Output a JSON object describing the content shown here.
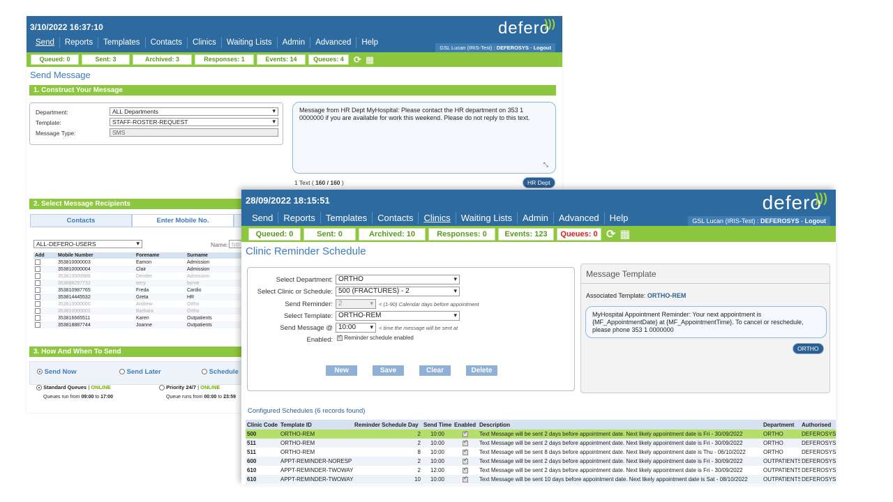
{
  "back": {
    "datetime": "3/10/2022 16:37:10",
    "nav": [
      "Send",
      "Reports",
      "Templates",
      "Contacts",
      "Clinics",
      "Waiting Lists",
      "Admin",
      "Advanced",
      "Help"
    ],
    "logo": "defero",
    "user_prefix": "GSL Lucan (IRIS-Test) : ",
    "user_name": "DEFEROSYS",
    "logout": "Logout",
    "queues": [
      "Queued: 0",
      "Sent: 3",
      "Archived: 3",
      "Responses: 1",
      "Events: 14",
      "Queues: 4"
    ],
    "page_title": "Send Message",
    "sec1": "1. Construct Your Message",
    "department_label": "Department:",
    "department_value": "ALL Departments",
    "template_label": "Template:",
    "template_value": "STAFF-ROSTER-REQUEST",
    "msgtype_label": "Message Type:",
    "msgtype_value": "SMS",
    "message_text": "Message from HR Dept MyHospital: Please contact the HR department on 353 1 0000000 if you are available for work this weekend. Please do not reply to this text.",
    "count_prefix": "1 Text ( ",
    "count_value": "160 / 160",
    "count_suffix": " )",
    "tag": "HR Dept",
    "sec2": "2. Select Message Recipients",
    "tab_contacts": "Contacts",
    "tab_mobile": "Enter Mobile No.",
    "group_value": "ALL-DEFERO-USERS",
    "name_label": "Name:",
    "name_placeholder": "typ",
    "recip_headers": [
      "Add",
      "Mobile Number",
      "Forename",
      "Surname"
    ],
    "recipients": [
      {
        "mobile": "353810000003",
        "forename": "Eamon",
        "surname": "Admission",
        "dim": false
      },
      {
        "mobile": "353810000004",
        "forename": "Clair",
        "surname": "Admission",
        "dim": false
      },
      {
        "mobile": "353810009988",
        "forename": "Deirdre",
        "surname": "Admission",
        "dim": true
      },
      {
        "mobile": "353888297732",
        "forename": "terry",
        "surname": "byrne",
        "dim": true
      },
      {
        "mobile": "353810987765",
        "forename": "Freda",
        "surname": "Cardio",
        "dim": false
      },
      {
        "mobile": "353814445532",
        "forename": "Greta",
        "surname": "HR",
        "dim": false
      },
      {
        "mobile": "353810000000",
        "forename": "Andrew",
        "surname": "Ortho",
        "dim": true
      },
      {
        "mobile": "353810000001",
        "forename": "Barbara",
        "surname": "Ortho",
        "dim": true
      },
      {
        "mobile": "353816665511",
        "forename": "Karen",
        "surname": "Outpatients",
        "dim": false
      },
      {
        "mobile": "353818887744",
        "forename": "Joanne",
        "surname": "Outpatients",
        "dim": false
      }
    ],
    "sec3": "3. How And When To Send",
    "send_now": "Send Now",
    "send_later": "Send Later",
    "schedule": "Schedule",
    "std_queues": "Standard Queues",
    "online": "ONLINE",
    "priority": "Priority 24/7",
    "std_hours_prefix": "Queues run from ",
    "std_from": "09:00",
    "to_word": " to ",
    "std_to": "17:00",
    "pri_hours_prefix": "Queue runs from ",
    "pri_from": "00:00",
    "pri_to": "23:59"
  },
  "front": {
    "datetime": "28/09/2022 18:15:51",
    "nav": [
      "Send",
      "Reports",
      "Templates",
      "Contacts",
      "Clinics",
      "Waiting Lists",
      "Admin",
      "Advanced",
      "Help"
    ],
    "logo": "defero",
    "user_prefix": "GSL Lucan (IRIS-Test) : ",
    "user_name": "DEFEROSYS",
    "logout": "Logout",
    "queues": [
      "Queued: 0",
      "Sent: 0",
      "Archived: 10",
      "Responses: 0",
      "Events: 123",
      "Queues: 0"
    ],
    "page_title": "Clinic Reminder Schedule",
    "dept_label": "Select Department:",
    "dept_value": "ORTHO",
    "clinic_label": "Select Clinic or Schedule:",
    "clinic_value": "500 (FRACTURES) - 2",
    "reminder_label": "Send Reminder:",
    "reminder_value": "2",
    "reminder_hint": "< (1-90) Calendar days before appointment",
    "template_label": "Select Template:",
    "template_value": "ORTHO-REM",
    "sendat_label": "Send Message @",
    "sendat_value": "10:00",
    "sendat_hint": "< time the message will be sent at",
    "enabled_label": "Enabled:",
    "enabled_text": "Reminder schedule enabled",
    "btn_new": "New",
    "btn_save": "Save",
    "btn_clear": "Clear",
    "btn_delete": "Delete",
    "mt_title": "Message Template",
    "assoc_label": "Associated Template: ",
    "assoc_value": "ORTHO-REM",
    "template_text": "MyHospital Appointment Reminder: Your next appointment is {MF_AppointmentDate} at {MF_AppointmentTime}. To cancel or reschedule, please phone 353 1 0000000",
    "tag": "ORTHO",
    "configured_title": "Configured Schedules (6 records found)",
    "sched_headers": [
      "Clinic Code",
      "Template ID",
      "Reminder Schedule Day",
      "Send Time",
      "Enabled",
      "Description",
      "Department",
      "Authorised"
    ],
    "schedules": [
      {
        "code": "500",
        "template": "ORTHO-REM",
        "day": "2",
        "time": "10:00",
        "desc": "Text Message will be sent 2 days before appointment date. Next likely appointment date is Fri - 30/09/2022",
        "dept": "ORTHO",
        "auth": "DEFEROSYS"
      },
      {
        "code": "511",
        "template": "ORTHO-REM",
        "day": "2",
        "time": "10:00",
        "desc": "Text Message will be sent 2 days before appointment date. Next likely appointment date is Fri - 30/09/2022",
        "dept": "ORTHO",
        "auth": "DEFEROSYS"
      },
      {
        "code": "511",
        "template": "ORTHO-REM",
        "day": "8",
        "time": "10:00",
        "desc": "Text Message will be sent 8 days before appointment date. Next likely appointment date is Thu - 06/10/2022",
        "dept": "ORTHO",
        "auth": "DEFEROSYS"
      },
      {
        "code": "600",
        "template": "APPT-REMINDER-NORESP",
        "day": "2",
        "time": "10:00",
        "desc": "Text Message will be sent 2 days before appointment date. Next likely appointment date is Fri - 30/09/2022",
        "dept": "OUTPATIENTS",
        "auth": "DEFEROSYS"
      },
      {
        "code": "610",
        "template": "APPT-REMINDER-TWOWAY",
        "day": "2",
        "time": "12:00",
        "desc": "Text Message will be sent 2 days before appointment date. Next likely appointment date is Fri - 30/09/2022",
        "dept": "OUTPATIENTS",
        "auth": "DEFEROSYS"
      },
      {
        "code": "610",
        "template": "APPT-REMINDER-TWOWAY",
        "day": "10",
        "time": "10:00",
        "desc": "Text Message will be sent 10 days before appointment date. Next likely appointment date is Sat - 08/10/2022",
        "dept": "OUTPATIENTS",
        "auth": "DEFEROSYS"
      }
    ]
  }
}
